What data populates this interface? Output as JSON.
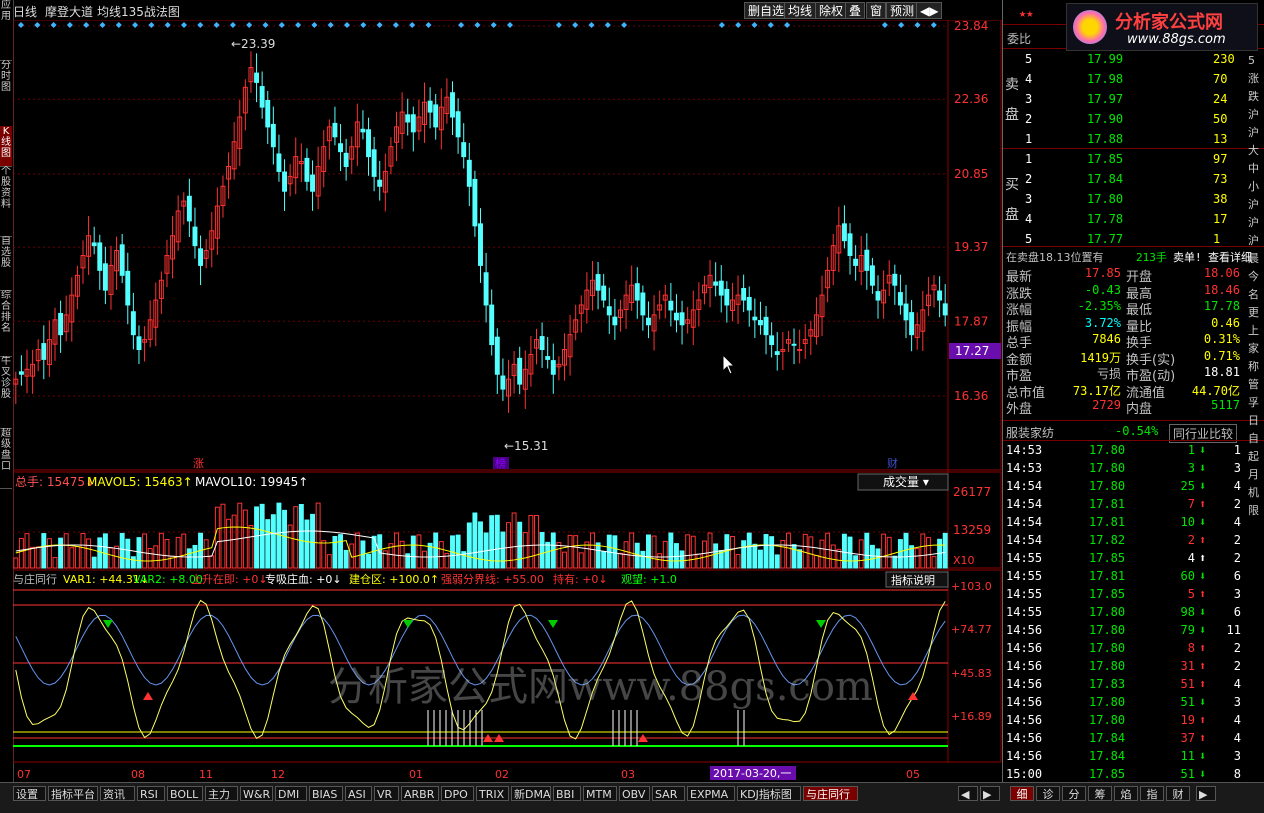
{
  "sidebar": [
    {
      "label": "应用",
      "active": false
    },
    {
      "label": "分时图",
      "active": false
    },
    {
      "label": "K线图",
      "active": true
    },
    {
      "label": "个股资料",
      "active": false
    },
    {
      "label": "自选股",
      "active": false
    },
    {
      "label": "综合排名",
      "active": false
    },
    {
      "label": "牛叉诊股",
      "active": false
    },
    {
      "label": "超级盘口",
      "active": false
    }
  ],
  "header": {
    "period": "日线",
    "stock_name": "摩登大道",
    "indicator": "均线135战法图"
  },
  "toolbar": [
    {
      "label": "删自选"
    },
    {
      "label": "均线"
    },
    {
      "label": "除权"
    },
    {
      "label": "叠"
    },
    {
      "label": "窗"
    },
    {
      "label": "预测"
    },
    {
      "label": "◀▶"
    }
  ],
  "price_axis": [
    "23.84",
    "22.36",
    "20.85",
    "19.37",
    "17.87",
    "16.36"
  ],
  "current_price_tag": "17.27",
  "price_annotations": {
    "high": "23.39",
    "low": "15.31"
  },
  "event_markers": [
    {
      "label": "涨"
    },
    {
      "label": "榜"
    },
    {
      "label": "财"
    }
  ],
  "volume_panel": {
    "legend": [
      {
        "text": "总手: 15475↓",
        "color": "#ff5050"
      },
      {
        "text": "MAVOL5: 15463↑",
        "color": "#ffff00"
      },
      {
        "text": "MAVOL10: 19945↑",
        "color": "#ffffff"
      }
    ],
    "selector": "成交量",
    "axis": [
      "26177",
      "13259"
    ],
    "unit": "X10"
  },
  "indicator_panel": {
    "legend": [
      {
        "text": "与庄同行",
        "color": "#c0c0c0"
      },
      {
        "text": "VAR1: +44.31↓",
        "color": "#ffff00"
      },
      {
        "text": "VAR2: +8.00",
        "color": "#00ff00"
      },
      {
        "text": "上升在即: +0↓",
        "color": "#ff3232"
      },
      {
        "text": "专吸庄血: +0↓",
        "color": "#ffffff"
      },
      {
        "text": "建仓区: +100.0↑",
        "color": "#ffff00"
      },
      {
        "text": "强弱分界线: +55.00",
        "color": "#ff3232"
      },
      {
        "text": "持有: +0↓",
        "color": "#ff3232"
      },
      {
        "text": "观望: +1.0",
        "color": "#00ff00"
      }
    ],
    "button": "指标说明",
    "axis": [
      "+103.0",
      "+74.77",
      "+45.83",
      "+16.89"
    ]
  },
  "watermark": "分析家公式网www.88gs.com",
  "x_axis": {
    "labels": [
      "07",
      "08",
      "11",
      "12",
      "01",
      "02",
      "03",
      "04",
      "05"
    ],
    "cursor_date": "2017-03-20,一"
  },
  "bottom_tabs": [
    "设置",
    "指标平台",
    "资讯",
    "RSI",
    "BOLL",
    "主力",
    "W&R",
    "DMI",
    "BIAS",
    "ASI",
    "VR",
    "ARBR",
    "DPO",
    "TRIX",
    "新DMA",
    "BBI",
    "MTM",
    "OBV",
    "SAR",
    "EXPMA",
    "KDJ指标图",
    "与庄同行"
  ],
  "right_tabs": [
    "细",
    "诊",
    "分",
    "筹",
    "焰",
    "指",
    "财"
  ],
  "logo": {
    "text": "分析家公式网",
    "url": "www.88gs.com"
  },
  "stars": "★★",
  "order_book": {
    "title": "委比",
    "sell_label": "卖盘",
    "buy_label": "买盘",
    "sell": [
      {
        "level": "5",
        "price": "17.99",
        "vol": "230"
      },
      {
        "level": "4",
        "price": "17.98",
        "vol": "70"
      },
      {
        "level": "3",
        "price": "17.97",
        "vol": "24"
      },
      {
        "level": "2",
        "price": "17.90",
        "vol": "50"
      },
      {
        "level": "1",
        "price": "17.88",
        "vol": "13"
      }
    ],
    "buy": [
      {
        "level": "1",
        "price": "17.85",
        "vol": "97"
      },
      {
        "level": "2",
        "price": "17.84",
        "vol": "73"
      },
      {
        "level": "3",
        "price": "17.80",
        "vol": "38"
      },
      {
        "level": "4",
        "price": "17.78",
        "vol": "17"
      },
      {
        "level": "5",
        "price": "17.77",
        "vol": "1"
      }
    ]
  },
  "order_info": {
    "text": "在卖盘18.13位置有",
    "vol": "213手",
    "action": "卖单!",
    "detail": "查看详细"
  },
  "quote": [
    {
      "l1": "最新",
      "v1": "17.85",
      "c1": "red",
      "l2": "开盘",
      "v2": "18.06",
      "c2": "red"
    },
    {
      "l1": "涨跌",
      "v1": "-0.43",
      "c1": "grn",
      "l2": "最高",
      "v2": "18.46",
      "c2": "red"
    },
    {
      "l1": "涨幅",
      "v1": "-2.35%",
      "c1": "grn",
      "l2": "最低",
      "v2": "17.78",
      "c2": "grn"
    },
    {
      "l1": "振幅",
      "v1": "3.72%",
      "c1": "cyn",
      "l2": "量比",
      "v2": "0.46",
      "c2": "yel"
    },
    {
      "l1": "总手",
      "v1": "7846",
      "c1": "yel",
      "l2": "换手",
      "v2": "0.31%",
      "c2": "yel"
    },
    {
      "l1": "金额",
      "v1": "1419万",
      "c1": "yel",
      "l2": "换手(实)",
      "v2": "0.71%",
      "c2": "yel"
    },
    {
      "l1": "市盈",
      "v1": "亏损",
      "c1": "lbl",
      "l2": "市盈(动)",
      "v2": "18.81",
      "c2": "wht"
    },
    {
      "l1": "总市值",
      "v1": "73.17亿",
      "c1": "yel",
      "l2": "流通值",
      "v2": "44.70亿",
      "c2": "yel"
    },
    {
      "l1": "外盘",
      "v1": "2729",
      "c1": "red",
      "l2": "内盘",
      "v2": "5117",
      "c2": "grn"
    }
  ],
  "industry": {
    "name": "服装家纺",
    "change": "-0.54%",
    "button": "同行业比较"
  },
  "ticks": [
    {
      "time": "14:53",
      "price": "17.80",
      "vol": "1",
      "dir": "down",
      "n": "1"
    },
    {
      "time": "14:53",
      "price": "17.80",
      "vol": "3",
      "dir": "down",
      "n": "3"
    },
    {
      "time": "14:54",
      "price": "17.80",
      "vol": "25",
      "dir": "down",
      "n": "4"
    },
    {
      "time": "14:54",
      "price": "17.81",
      "vol": "7",
      "dir": "up",
      "n": "2"
    },
    {
      "time": "14:54",
      "price": "17.81",
      "vol": "10",
      "dir": "down",
      "n": "4"
    },
    {
      "time": "14:54",
      "price": "17.82",
      "vol": "2",
      "dir": "up",
      "n": "2"
    },
    {
      "time": "14:55",
      "price": "17.85",
      "vol": "4",
      "dir": "white",
      "n": "2"
    },
    {
      "time": "14:55",
      "price": "17.81",
      "vol": "60",
      "dir": "down",
      "n": "6"
    },
    {
      "time": "14:55",
      "price": "17.85",
      "vol": "5",
      "dir": "up",
      "n": "3"
    },
    {
      "time": "14:55",
      "price": "17.80",
      "vol": "98",
      "dir": "down",
      "n": "6"
    },
    {
      "time": "14:56",
      "price": "17.80",
      "vol": "79",
      "dir": "down",
      "n": "11"
    },
    {
      "time": "14:56",
      "price": "17.80",
      "vol": "8",
      "dir": "up",
      "n": "2"
    },
    {
      "time": "14:56",
      "price": "17.80",
      "vol": "31",
      "dir": "up",
      "n": "2"
    },
    {
      "time": "14:56",
      "price": "17.83",
      "vol": "51",
      "dir": "up",
      "n": "4"
    },
    {
      "time": "14:56",
      "price": "17.80",
      "vol": "51",
      "dir": "down",
      "n": "3"
    },
    {
      "time": "14:56",
      "price": "17.80",
      "vol": "19",
      "dir": "up",
      "n": "4"
    },
    {
      "time": "14:56",
      "price": "17.84",
      "vol": "37",
      "dir": "up",
      "n": "4"
    },
    {
      "time": "14:56",
      "price": "17.84",
      "vol": "11",
      "dir": "down",
      "n": "3"
    },
    {
      "time": "15:00",
      "price": "17.85",
      "vol": "51",
      "dir": "down",
      "n": "8"
    }
  ],
  "right_edge_text": "5 涨 跌 沪 沪 大 中 小 沪 沪 沪 晨 今 名 更 上 家 称 管 孚 日 自 起 月 机 限"
}
